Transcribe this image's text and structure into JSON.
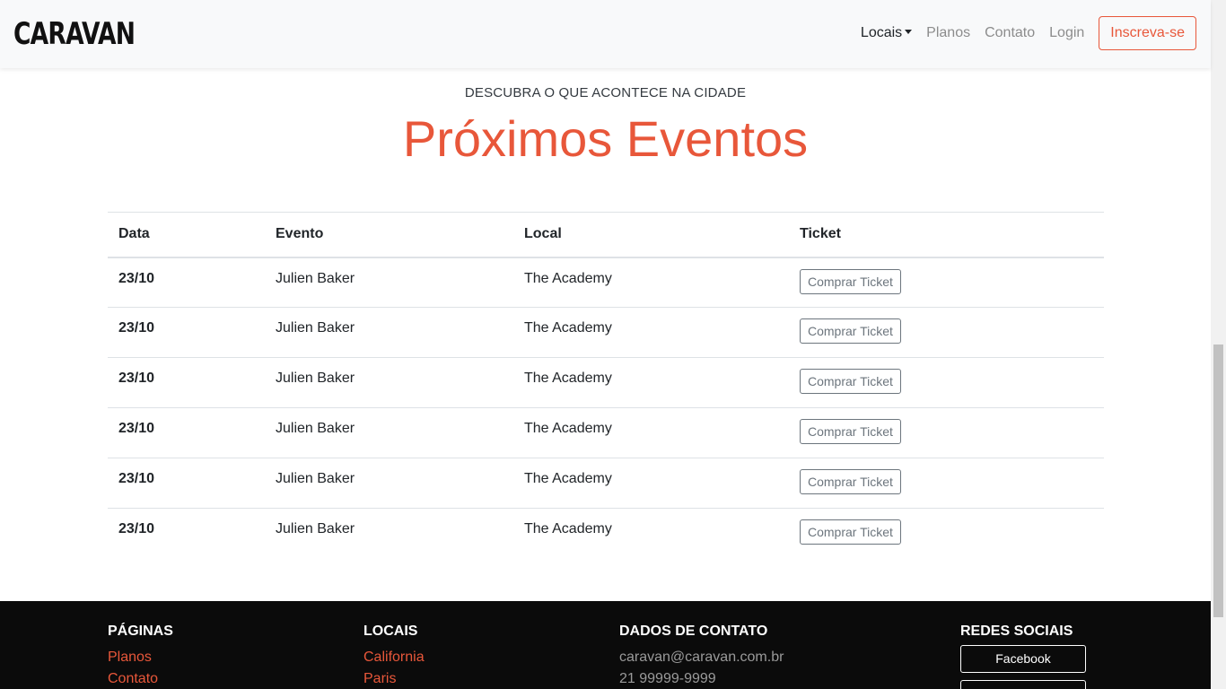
{
  "navbar": {
    "brand": "CARAVAN",
    "links": [
      "Locais",
      "Planos",
      "Contato",
      "Login"
    ],
    "signup": "Inscreva-se"
  },
  "hero": {
    "subtitle": "DESCUBRA O QUE ACONTECE NA CIDADE",
    "title": "Próximos Eventos"
  },
  "table": {
    "headers": [
      "Data",
      "Evento",
      "Local",
      "Ticket"
    ],
    "rows": [
      {
        "date": "23/10",
        "event": "Julien Baker",
        "venue": "The Academy",
        "ticket": "Comprar Ticket"
      },
      {
        "date": "23/10",
        "event": "Julien Baker",
        "venue": "The Academy",
        "ticket": "Comprar Ticket"
      },
      {
        "date": "23/10",
        "event": "Julien Baker",
        "venue": "The Academy",
        "ticket": "Comprar Ticket"
      },
      {
        "date": "23/10",
        "event": "Julien Baker",
        "venue": "The Academy",
        "ticket": "Comprar Ticket"
      },
      {
        "date": "23/10",
        "event": "Julien Baker",
        "venue": "The Academy",
        "ticket": "Comprar Ticket"
      },
      {
        "date": "23/10",
        "event": "Julien Baker",
        "venue": "The Academy",
        "ticket": "Comprar Ticket"
      }
    ]
  },
  "footer": {
    "pages": {
      "heading": "PÁGINAS",
      "links": [
        "Planos",
        "Contato"
      ]
    },
    "locations": {
      "heading": "LOCAIS",
      "links": [
        "California",
        "Paris"
      ]
    },
    "contact": {
      "heading": "DADOS DE CONTATO",
      "email": "caravan@caravan.com.br",
      "phone": "21 99999-9999"
    },
    "social": {
      "heading": "REDES SOCIAIS",
      "buttons": [
        "Facebook",
        ""
      ]
    }
  },
  "colors": {
    "accent": "#e8573a",
    "footer_bg": "#0b0b0b",
    "navbar_bg": "#f8f9fa"
  }
}
